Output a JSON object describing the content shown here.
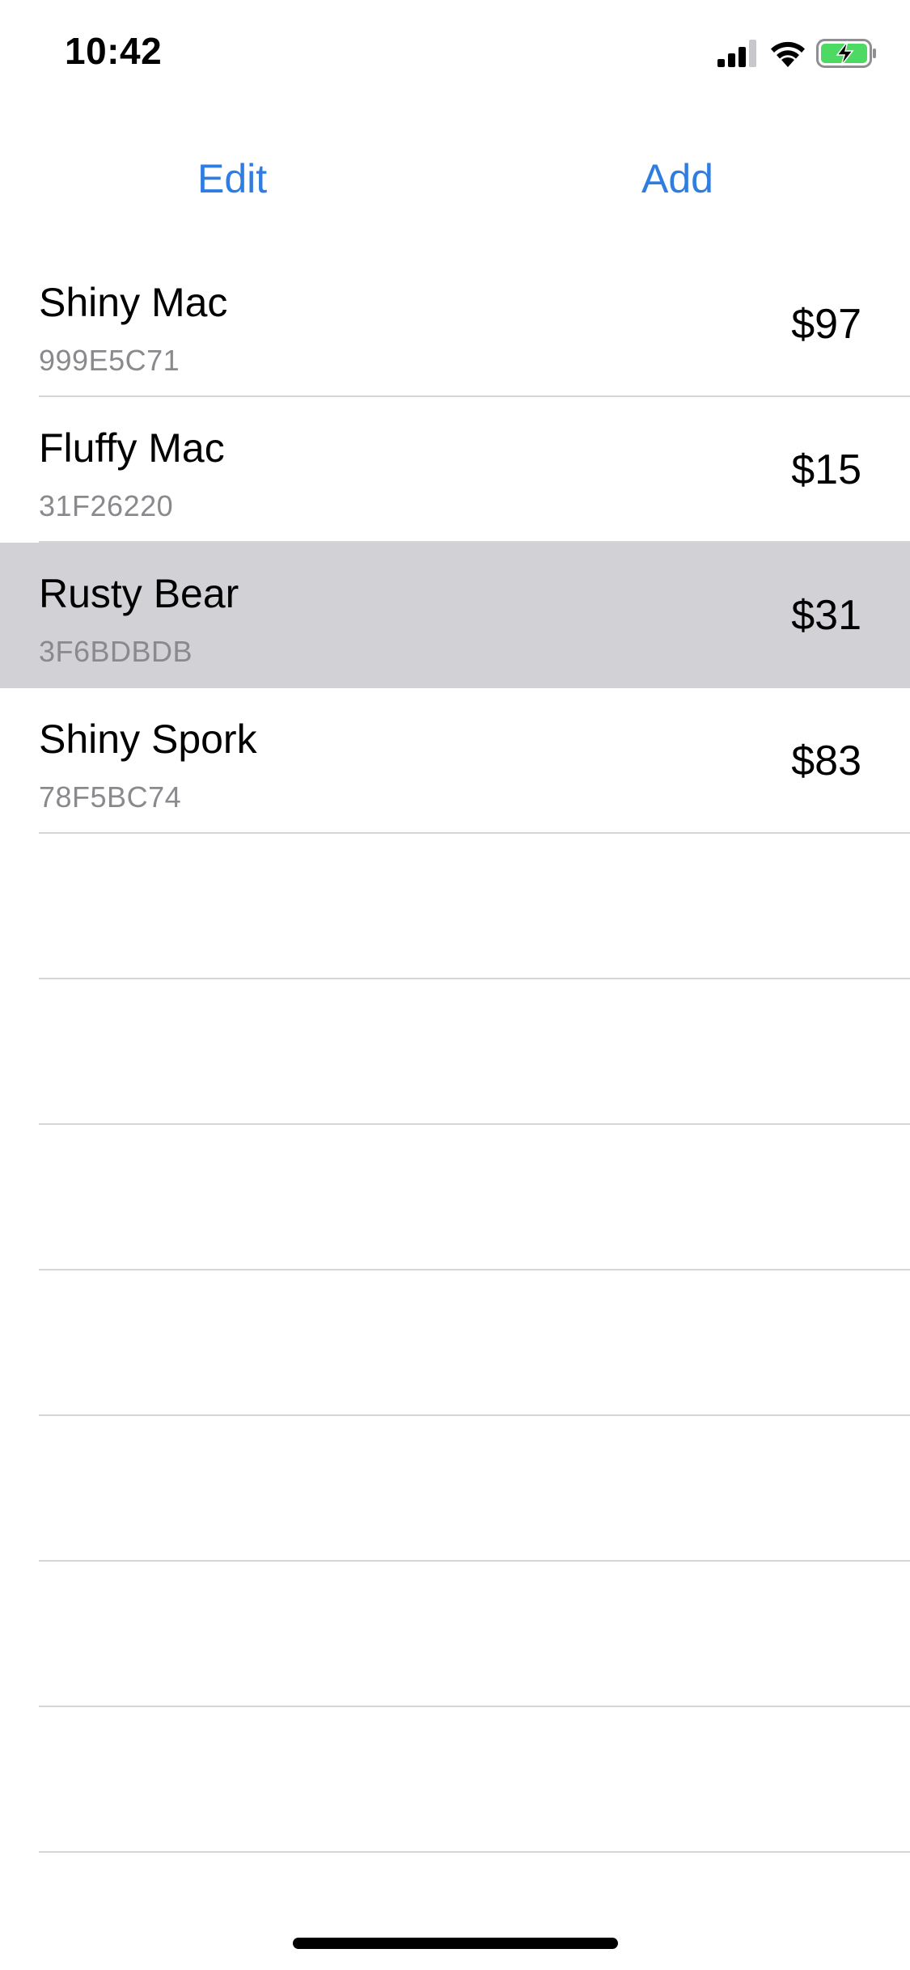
{
  "status_bar": {
    "time": "10:42",
    "icons": [
      "cellular-signal-icon",
      "wifi-icon",
      "battery-charging-icon"
    ],
    "battery_color": "#4cd964"
  },
  "toolbar": {
    "edit_label": "Edit",
    "add_label": "Add",
    "accent_color": "#2f7de1"
  },
  "items": [
    {
      "title": "Shiny Mac",
      "subtitle": "999E5C71",
      "price": "$97",
      "selected": false
    },
    {
      "title": "Fluffy Mac",
      "subtitle": "31F26220",
      "price": "$15",
      "selected": false
    },
    {
      "title": "Rusty Bear",
      "subtitle": "3F6BDBDB",
      "price": "$31",
      "selected": true
    },
    {
      "title": "Shiny Spork",
      "subtitle": "78F5BC74",
      "price": "$83",
      "selected": false
    }
  ],
  "selection_color": "#d1d1d6"
}
